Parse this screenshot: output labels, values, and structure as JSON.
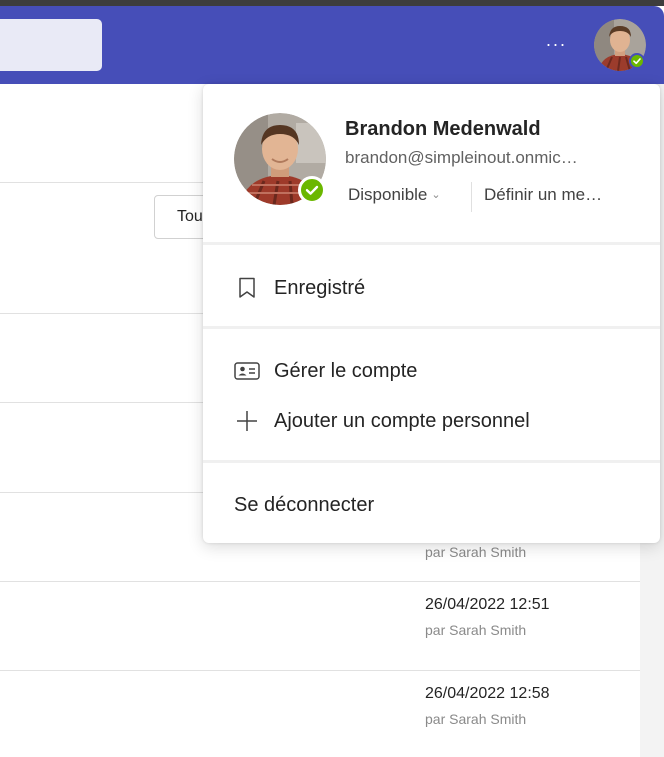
{
  "topbar": {
    "more_label": "···",
    "accent_color": "#464eb8"
  },
  "background": {
    "filter_label": "Tou",
    "entries": [
      {
        "date": "",
        "by": "par Sarah Smith"
      },
      {
        "date": "26/04/2022 12:51",
        "by": "par Sarah Smith"
      },
      {
        "date": "26/04/2022 12:58",
        "by": "par Sarah Smith"
      }
    ]
  },
  "profile_menu": {
    "user": {
      "name": "Brandon Medenwald",
      "email": "brandon@simpleinout.onmic…",
      "status": "Disponible",
      "status_chevron": "⌄",
      "status_message": "Définir un me…",
      "status_color": "#6bb700"
    },
    "items": {
      "saved": "Enregistré",
      "manage_account": "Gérer le compte",
      "add_personal_account": "Ajouter un compte personnel",
      "sign_out": "Se déconnecter"
    }
  }
}
